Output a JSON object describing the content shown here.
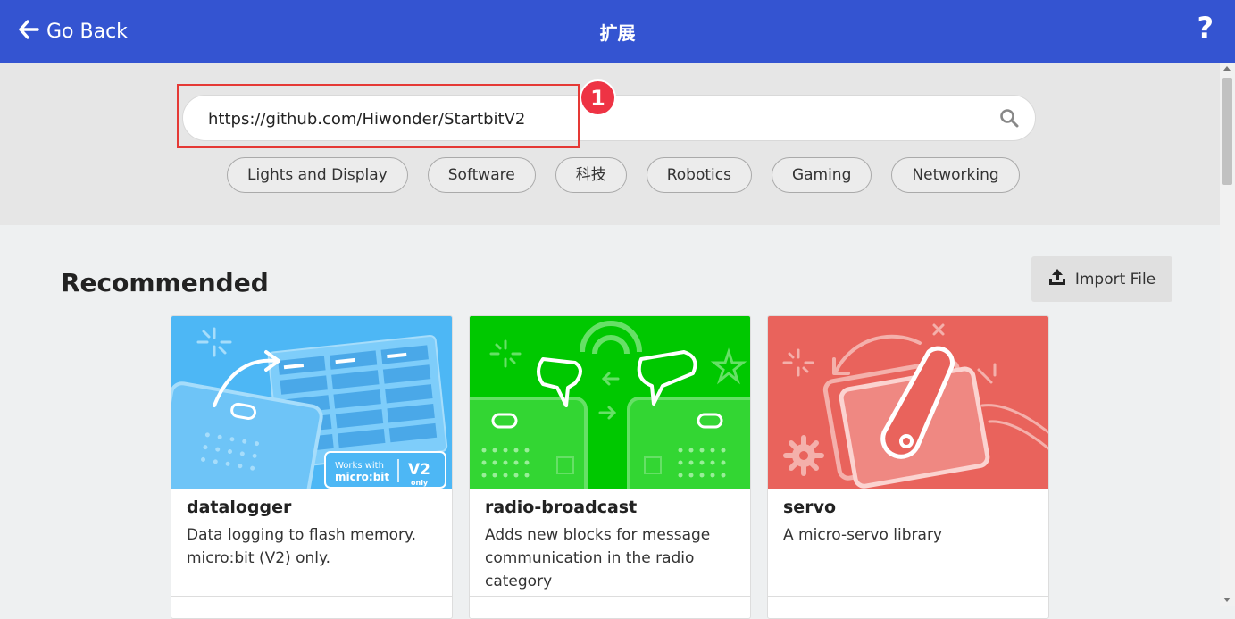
{
  "header": {
    "back_label": "Go Back",
    "title": "扩展",
    "help_label": "?"
  },
  "search": {
    "value": "https://github.com/Hiwonder/StartbitV2",
    "placeholder": "",
    "step_number": "1"
  },
  "categories": [
    "Lights and Display",
    "Software",
    "科技",
    "Robotics",
    "Gaming",
    "Networking"
  ],
  "recommended": {
    "title": "Recommended",
    "import_label": "Import File",
    "cards": [
      {
        "name": "datalogger",
        "description": "Data logging to flash memory. micro:bit (V2) only.",
        "badge_line1": "Works with",
        "badge_line2": "micro:bit",
        "badge_v2": "V2",
        "badge_only": "only"
      },
      {
        "name": "radio-broadcast",
        "description": "Adds new blocks for message communication in the radio category"
      },
      {
        "name": "servo",
        "description": "A micro-servo library"
      }
    ]
  },
  "colors": {
    "header": "#3454d1",
    "datalogger_bg": "#4db7f5",
    "radio_bg": "#00c800",
    "servo_bg": "#e9635c",
    "step_badge": "#ee3344"
  }
}
